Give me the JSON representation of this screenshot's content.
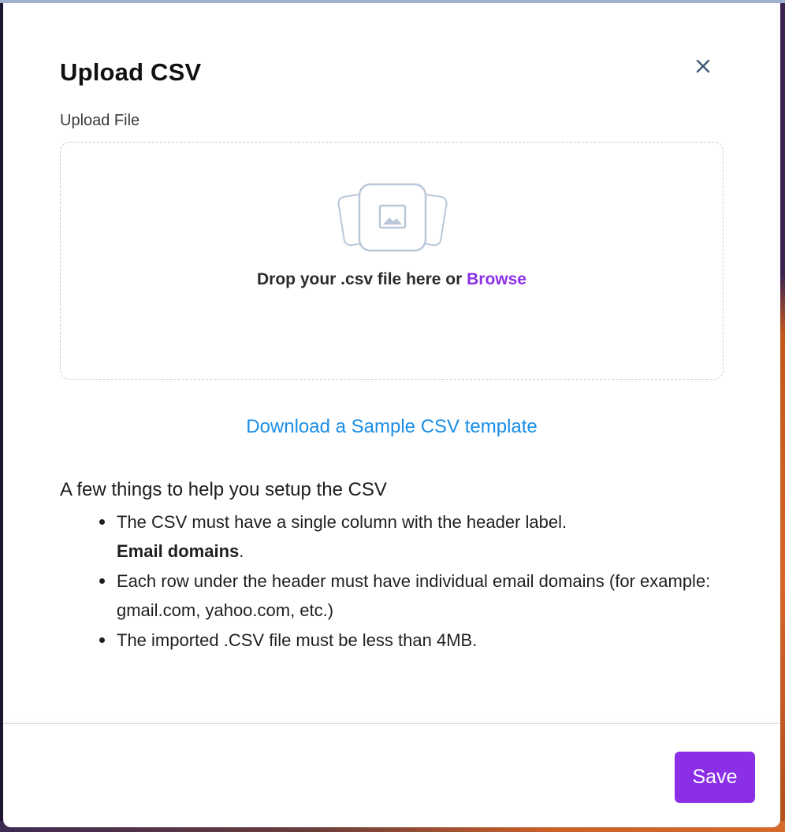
{
  "modal": {
    "title": "Upload CSV",
    "close_icon": "close-icon"
  },
  "upload": {
    "label": "Upload File",
    "drop_text": "Drop your .csv file here or ",
    "browse_label": "Browse",
    "illustration_icon": "image-icon"
  },
  "sample_link": "Download a Sample CSV template",
  "help": {
    "heading": "A few things to help you setup the CSV",
    "items": [
      {
        "text": "The CSV must have a single column with the header label.",
        "bold": "Email domains",
        "suffix": "."
      },
      {
        "text": "Each row under the header must have individual email domains (for example: gmail.com, yahoo.com, etc.)"
      },
      {
        "text": "The imported .CSV file must be less than 4MB."
      }
    ]
  },
  "footer": {
    "save_label": "Save"
  },
  "colors": {
    "accent": "#8b2fe6",
    "link": "#1a8ee6",
    "close_icon": "#3f5a78"
  }
}
